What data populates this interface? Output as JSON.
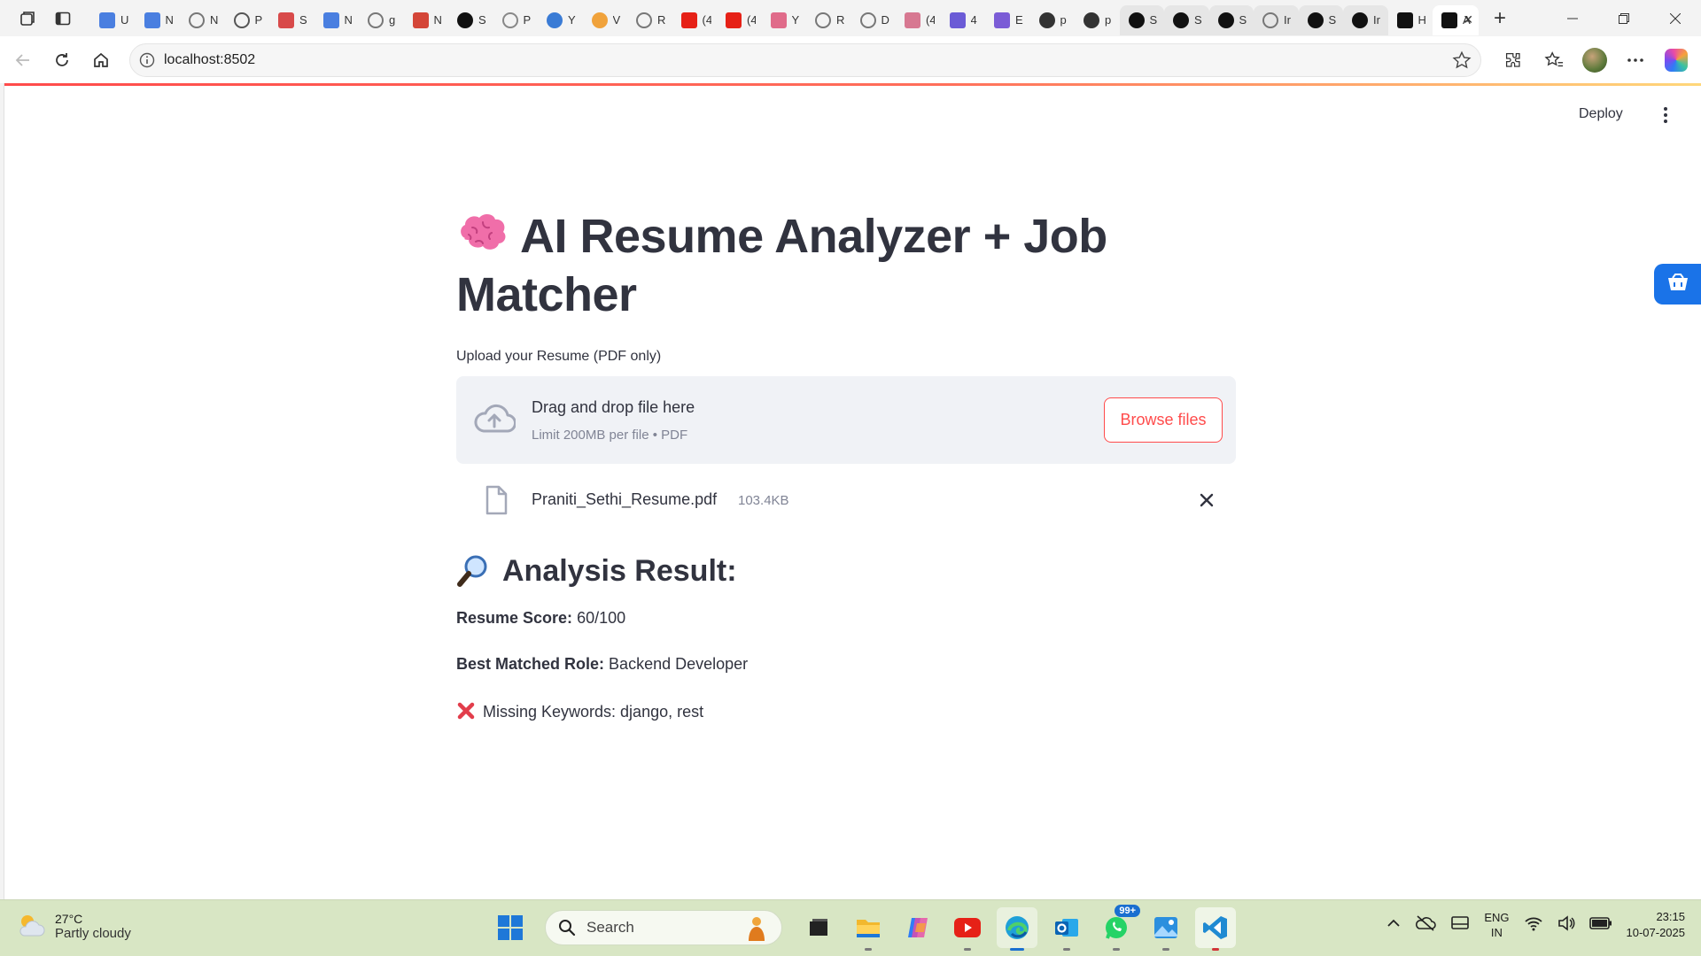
{
  "browser": {
    "url": "localhost:8502",
    "tabs": [
      {
        "title": "U",
        "icon": "docs-icon",
        "color": "#4a7fe0"
      },
      {
        "title": "N",
        "icon": "docs-icon",
        "color": "#4a7fe0"
      },
      {
        "title": "N",
        "icon": "globe-icon",
        "color": "#777777"
      },
      {
        "title": "P",
        "icon": "gear-icon",
        "color": "#555555"
      },
      {
        "title": "S",
        "icon": "pdf-icon",
        "color": "#d84a4a"
      },
      {
        "title": "N",
        "icon": "docs-icon",
        "color": "#4a7fe0"
      },
      {
        "title": "g",
        "icon": "search-icon",
        "color": "#777777"
      },
      {
        "title": "N",
        "icon": "gmail-icon",
        "color": "#d44638"
      },
      {
        "title": "S",
        "icon": "openai-icon",
        "color": "#111111"
      },
      {
        "title": "P",
        "icon": "m-icon",
        "color": "#888888"
      },
      {
        "title": "Y",
        "icon": "blue-circle-icon",
        "color": "#3a7bd5"
      },
      {
        "title": "V",
        "icon": "orange-ring-icon",
        "color": "#f0a23b"
      },
      {
        "title": "R",
        "icon": "globe-icon",
        "color": "#777777"
      },
      {
        "title": "(4",
        "icon": "youtube-icon",
        "color": "#e62117"
      },
      {
        "title": "(4",
        "icon": "youtube-icon",
        "color": "#e62117"
      },
      {
        "title": "Y",
        "icon": "pink-icon",
        "color": "#e06b8a"
      },
      {
        "title": "R",
        "icon": "lock-icon",
        "color": "#777777"
      },
      {
        "title": "D",
        "icon": "globe-icon",
        "color": "#777777"
      },
      {
        "title": "(4",
        "icon": "video-icon",
        "color": "#d77891"
      },
      {
        "title": "4",
        "icon": "purple-icon",
        "color": "#6b5bd6"
      },
      {
        "title": "E",
        "icon": "list-icon",
        "color": "#7b5cd6"
      },
      {
        "title": "p",
        "icon": "github-icon",
        "color": "#333333"
      },
      {
        "title": "p",
        "icon": "github-icon",
        "color": "#333333"
      },
      {
        "title": "S",
        "icon": "crown-icon",
        "color": "#111111"
      },
      {
        "title": "S",
        "icon": "crown-icon",
        "color": "#111111"
      },
      {
        "title": "S",
        "icon": "crown-icon",
        "color": "#111111"
      },
      {
        "title": "Ir",
        "icon": "gear-icon",
        "color": "#777777"
      },
      {
        "title": "S",
        "icon": "crown-icon",
        "color": "#111111"
      },
      {
        "title": "Ir",
        "icon": "openai-icon",
        "color": "#111111"
      },
      {
        "title": "H",
        "icon": "swirl-icon",
        "color": "#111111"
      },
      {
        "title": "A",
        "icon": "swirl-icon",
        "color": "#111111"
      }
    ]
  },
  "app": {
    "deploy_label": "Deploy",
    "title_line1": "AI Resume Analyzer + Job",
    "title_line2": "Matcher",
    "title_emoji": "brain-icon",
    "upload_label": "Upload your Resume (PDF only)",
    "dropzone_title": "Drag and drop file here",
    "dropzone_limit": "Limit 200MB per file • PDF",
    "browse_label": "Browse files",
    "file_name": "Praniti_Sethi_Resume.pdf",
    "file_size": "103.4KB",
    "analysis_heading": "Analysis Result:",
    "score_label": "Resume Score:",
    "score_value": "60/100",
    "role_label": "Best Matched Role:",
    "role_value": "Backend Developer",
    "missing_text": "Missing Keywords: django, rest"
  },
  "taskbar": {
    "weather_temp": "27°C",
    "weather_desc": "Partly cloudy",
    "search_placeholder": "Search",
    "whatsapp_badge": "99+",
    "lang_line1": "ENG",
    "lang_line2": "IN",
    "time": "23:15",
    "date": "10-07-2025"
  },
  "colors": {
    "accent": "#ff4b4b",
    "text": "#31333f",
    "muted": "#808495",
    "dropzone_bg": "#f0f2f6",
    "taskbar_bg": "#d8e6c4"
  }
}
